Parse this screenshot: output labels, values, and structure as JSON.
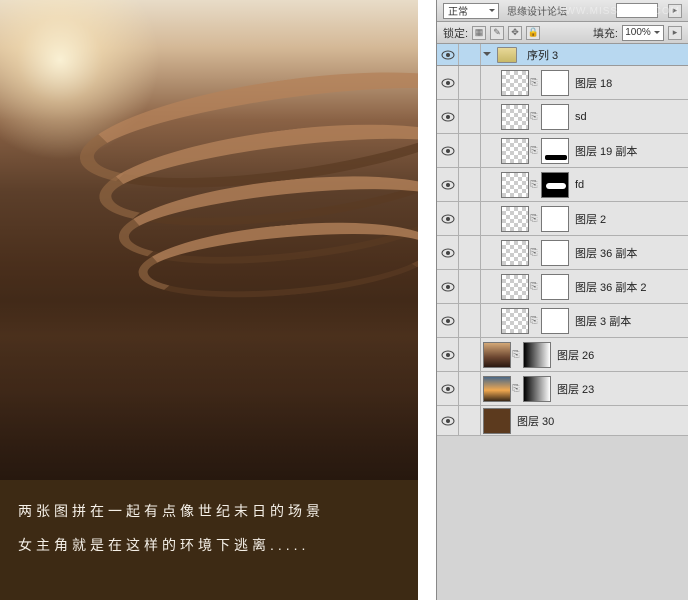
{
  "watermark": "WWW.MISSYUAN.COM",
  "canvas": {
    "overlay_text": "思缘设计论坛",
    "caption_line1": "两张图拼在一起有点像世纪末日的场景",
    "caption_line2": "女主角就是在这样的环境下逃离....."
  },
  "topbar": {
    "blend_mode": "正常",
    "opacity_label": "",
    "opacity_value": ""
  },
  "lockbar": {
    "lock_label": "锁定:",
    "fill_label": "填充:",
    "fill_value": "100%"
  },
  "group": {
    "name": "序列 3"
  },
  "layers": [
    {
      "name": "图层 18",
      "thumb": "chk",
      "mask": "mask"
    },
    {
      "name": "sd",
      "thumb": "chk",
      "mask": "mask"
    },
    {
      "name": "图层 19 副本",
      "thumb": "chk",
      "mask": "maskbrush"
    },
    {
      "name": "fd",
      "thumb": "chk",
      "mask": "maskblk2"
    },
    {
      "name": "图层 2",
      "thumb": "chk",
      "mask": "mask"
    },
    {
      "name": "图层 36 副本",
      "thumb": "chk",
      "mask": "mask"
    },
    {
      "name": "图层 36 副本 2",
      "thumb": "chk",
      "mask": "mask"
    },
    {
      "name": "图层 3 副本",
      "thumb": "chk",
      "mask": "mask"
    }
  ],
  "bottom_layers": [
    {
      "name": "图层 26",
      "thumb": "img1",
      "mask": "gradient"
    },
    {
      "name": "图层 23",
      "thumb": "img2",
      "mask": "gradient"
    },
    {
      "name": "图层 30",
      "thumb": "solid-brown",
      "mask": null
    }
  ]
}
